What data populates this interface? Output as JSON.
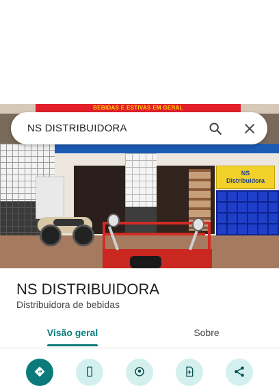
{
  "search": {
    "query": "NS DISTRIBUIDORA"
  },
  "photo": {
    "banner_text": "BEBIDAS E ESTIVAS EM GERAL",
    "sign_line1": "NS",
    "sign_line2": "Distribuidora"
  },
  "place": {
    "name": "NS DISTRIBUIDORA",
    "category": "Distribuidora de bebidas"
  },
  "tabs": [
    {
      "label": "Visão geral",
      "active": true
    },
    {
      "label": "Sobre",
      "active": false
    }
  ],
  "actions": [
    {
      "icon": "directions-icon"
    },
    {
      "icon": "phone-icon"
    },
    {
      "icon": "location-icon"
    },
    {
      "icon": "save-icon"
    },
    {
      "icon": "share-icon"
    }
  ],
  "colors": {
    "accent": "#0b7a7a",
    "action_bg": "#d3f0ef"
  }
}
